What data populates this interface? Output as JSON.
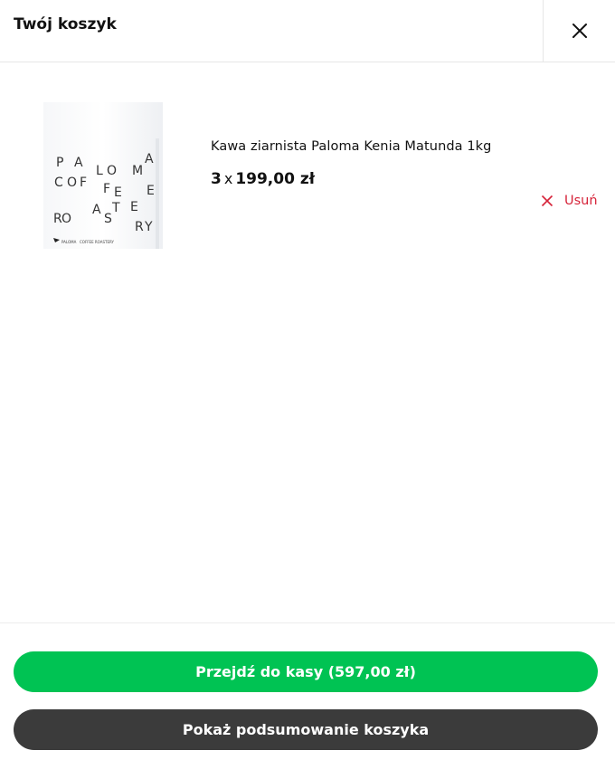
{
  "header": {
    "title": "Twój koszyk",
    "close_icon": "close-icon"
  },
  "cart": {
    "items": [
      {
        "name": "Kawa ziarnista Paloma Kenia Matunda 1kg",
        "quantity": "3",
        "multiplier": "x",
        "unit_price": "199,00 zł",
        "remove_label": "Usuń",
        "image_text": {
          "row1": [
            "P",
            "A",
            "L",
            "O",
            "M",
            "A"
          ],
          "row2": [
            "C",
            "O",
            "F",
            "F",
            "E",
            "E"
          ],
          "row3": [
            "R",
            "O",
            "A",
            "S",
            "T",
            "E",
            "R",
            "Y"
          ],
          "brand": "PALOMA",
          "brand_sub": "COFFEE ROASTERY"
        }
      }
    ]
  },
  "footer": {
    "checkout_label": "Przejdź do kasy (597,00 zł)",
    "summary_label": "Pokaż podsumowanie koszyka"
  },
  "colors": {
    "checkout_button": "#00c353",
    "summary_button": "#3b3b3b",
    "remove": "#d6243a"
  }
}
